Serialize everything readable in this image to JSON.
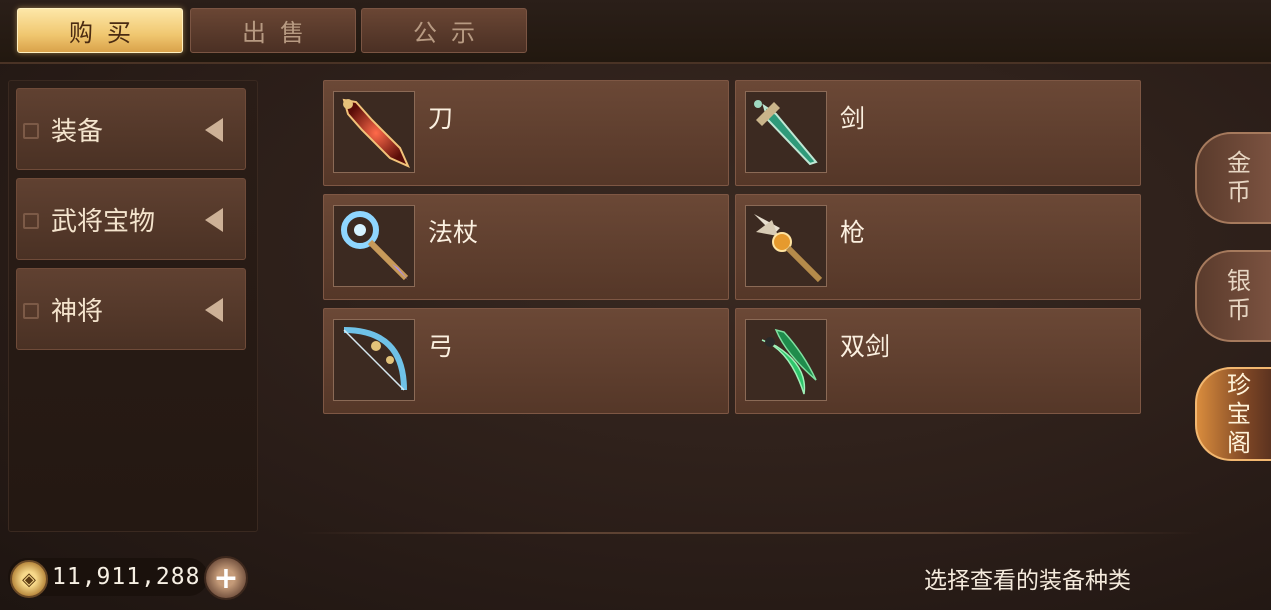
{
  "tabs": [
    {
      "label": "购买",
      "active": true
    },
    {
      "label": "出售",
      "active": false
    },
    {
      "label": "公示",
      "active": false
    }
  ],
  "categories": [
    {
      "label": "装备"
    },
    {
      "label": "武将宝物"
    },
    {
      "label": "神将"
    }
  ],
  "items": [
    {
      "name": "刀",
      "icon": "red-saber-icon"
    },
    {
      "name": "剑",
      "icon": "jade-sword-icon"
    },
    {
      "name": "法杖",
      "icon": "blue-staff-icon"
    },
    {
      "name": "枪",
      "icon": "golden-spear-icon"
    },
    {
      "name": "弓",
      "icon": "blue-bow-icon"
    },
    {
      "name": "双剑",
      "icon": "green-twin-swords-icon"
    }
  ],
  "side_tabs": [
    {
      "label": "金\n币",
      "active": false
    },
    {
      "label": "银\n币",
      "active": false
    },
    {
      "label": "珍\n宝\n阁",
      "active": true
    }
  ],
  "currency": {
    "amount": "11,911,288",
    "icon": "coin-icon"
  },
  "hint": "选择查看的装备种类",
  "colors": {
    "active_tab": "#f0c770",
    "panel": "#553728",
    "accent_side": "#d98c3d"
  }
}
